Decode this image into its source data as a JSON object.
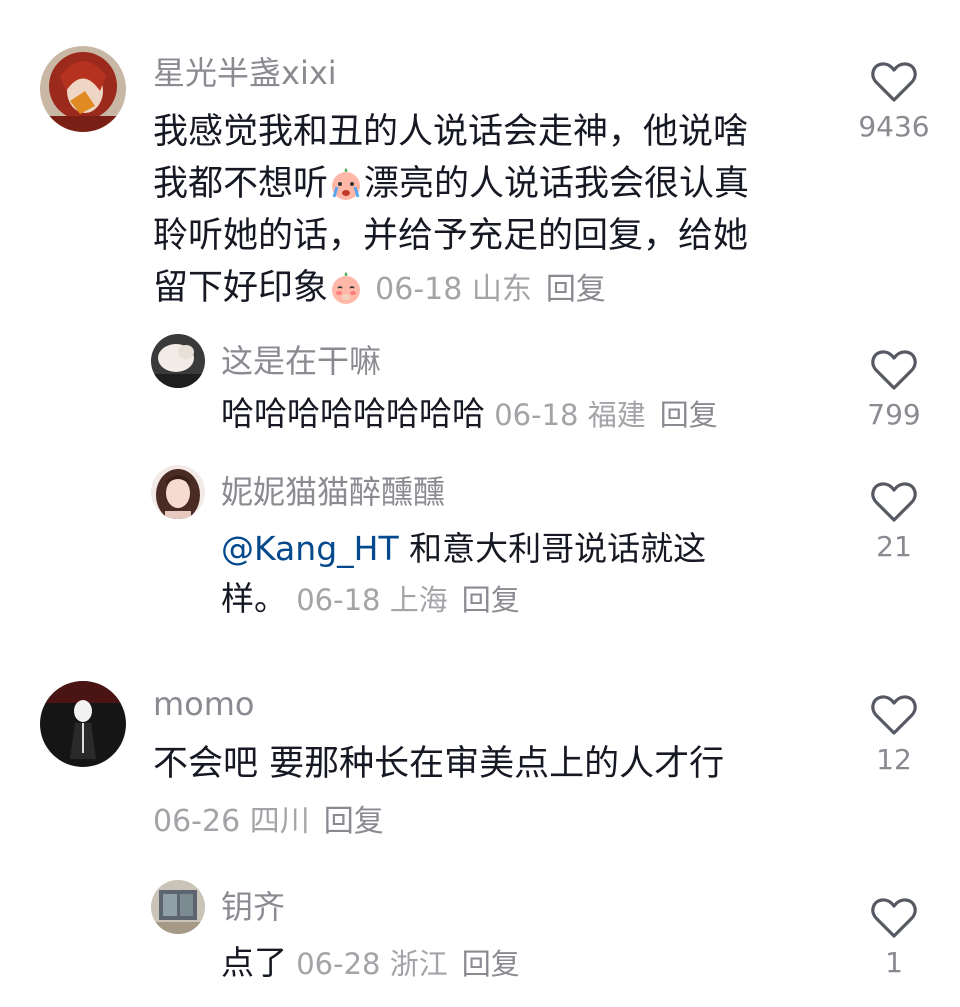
{
  "comments": [
    {
      "username": "星光半盏xixi",
      "lines": [
        "我感觉我和丑的人说话会走神，他说啥",
        "我都不想听",
        "漂亮的人说话我会很认真",
        "聆听她的话，并给予充足的回复，给她",
        "留下好印象"
      ],
      "date": "06-18",
      "location": "山东",
      "reply_label": "回复",
      "likes": "9436",
      "avatar_icon": "avatar-red-hair-icon",
      "emoji_icons": [
        "crying-peach-emoji-icon",
        "shy-peach-emoji-icon"
      ]
    },
    {
      "username": "这是在干嘛",
      "lines": [
        "哈哈哈哈哈哈哈哈"
      ],
      "date": "06-18",
      "location": "福建",
      "reply_label": "回复",
      "likes": "799",
      "avatar_icon": "avatar-white-cat-icon"
    },
    {
      "username": "妮妮猫猫醉醺醺",
      "mention": "@Kang_HT",
      "lines": [
        " 和意大利哥说话就这",
        "样。"
      ],
      "date": "06-18",
      "location": "上海",
      "reply_label": "回复",
      "likes": "21",
      "avatar_icon": "avatar-girl-portrait-icon"
    },
    {
      "username": "momo",
      "lines": [
        "不会吧 要那种长在审美点上的人才行"
      ],
      "date": "06-26",
      "location": "四川",
      "reply_label": "回复",
      "likes": "12",
      "avatar_icon": "avatar-dark-figure-icon"
    },
    {
      "username": "钥齐",
      "lines": [
        "点了"
      ],
      "date": "06-28",
      "location": "浙江",
      "reply_label": "回复",
      "likes": "1",
      "avatar_icon": "avatar-room-photo-icon"
    }
  ],
  "colors": {
    "text": "#161823",
    "secondary": "#8a8b91",
    "mention": "#04498d",
    "background": "#ffffff"
  }
}
